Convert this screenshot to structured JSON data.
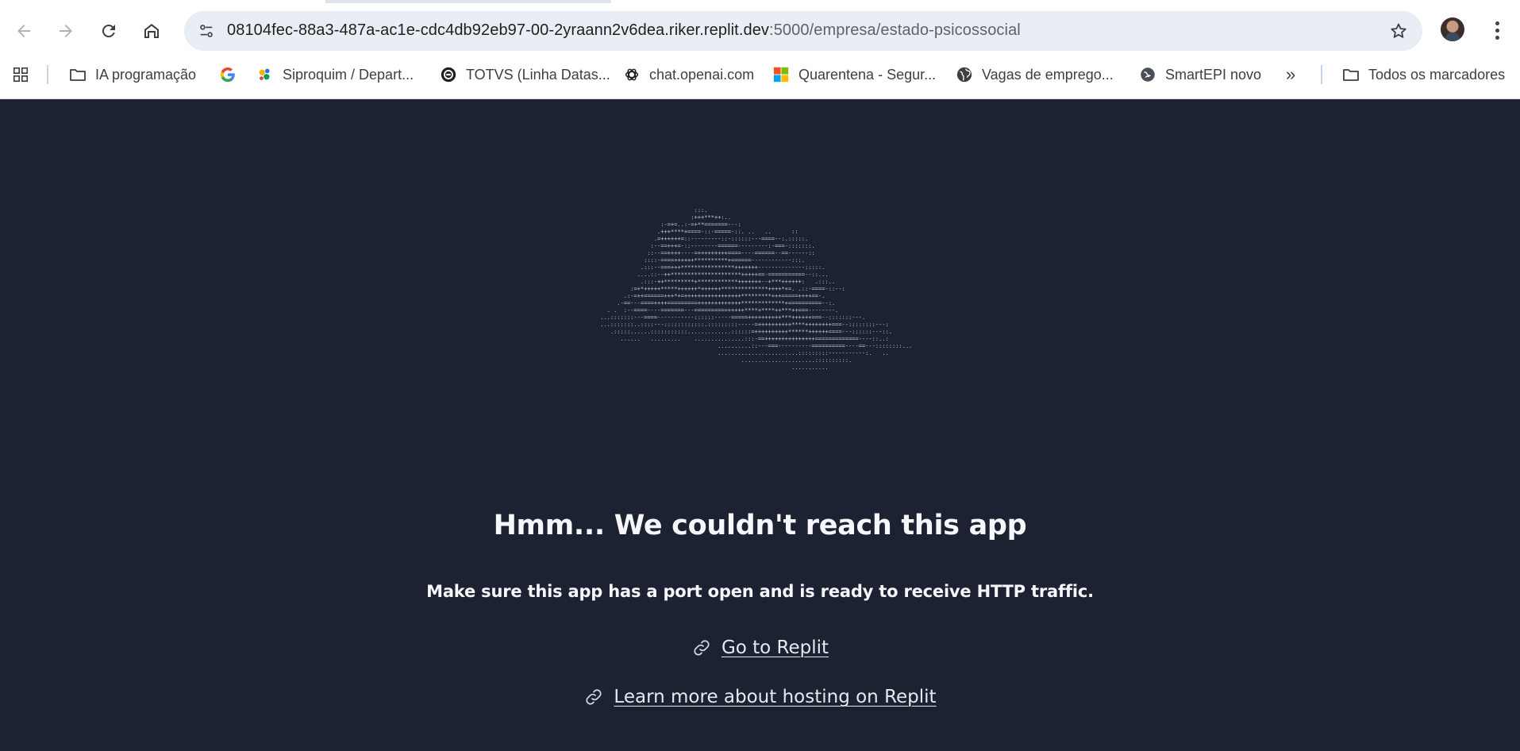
{
  "browser": {
    "url_host": "08104fec-88a3-487a-ac1e-cdc4db92eb97-00-2yraann2v6dea.riker.replit.dev",
    "url_path": ":5000/empresa/estado-psicossocial",
    "bookmarks": [
      {
        "label": "IA programação",
        "icon": "folder-icon"
      },
      {
        "label": "",
        "icon": "google-icon"
      },
      {
        "label": "Siproquim / Depart...",
        "icon": "siproquim-icon"
      },
      {
        "label": "TOTVS (Linha Datas...",
        "icon": "totvs-icon"
      },
      {
        "label": "chat.openai.com",
        "icon": "openai-icon"
      },
      {
        "label": "Quarentena - Segur...",
        "icon": "microsoft-icon"
      },
      {
        "label": "Vagas de emprego...",
        "icon": "globe-icon"
      },
      {
        "label": "SmartEPI novo",
        "icon": "smartepi-icon"
      }
    ],
    "overflow_label": "»",
    "all_bookmarks_label": "Todos os marcadores"
  },
  "page": {
    "headline": "Hmm... We couldn't reach this app",
    "subtext": "Make sure this app has a port open and is ready to receive HTTP traffic.",
    "links": [
      {
        "label": "Go to Replit",
        "icon": "link-icon"
      },
      {
        "label": "Learn more about hosting on Replit",
        "icon": "link-icon"
      }
    ],
    "colors": {
      "background": "#1c2232",
      "text": "#f5f7fa"
    }
  }
}
